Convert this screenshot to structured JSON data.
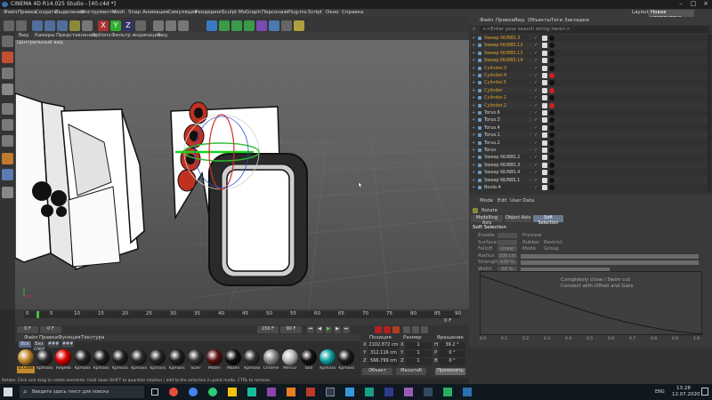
{
  "window": {
    "title": "CINEMA 4D R14.025 Studio - [40.c4d *]",
    "layout_label": "Layout:",
    "layout_value": "Новая компоновка"
  },
  "menu": [
    "Файл",
    "Правка",
    "Создать",
    "Выделение",
    "Инструменты",
    "Mesh",
    "Snap",
    "Анимация",
    "Симуляция",
    "Рендеринг",
    "Sculpt",
    "MoGraph",
    "Персонаж",
    "Plug-ins",
    "Script",
    "Окно",
    "Справка"
  ],
  "viewport": {
    "menu": [
      "Вид",
      "Камеры",
      "Представление",
      "Options",
      "Фильтр индикации",
      "Вид"
    ],
    "label": "Центральный вид"
  },
  "timeline": {
    "ticks": [
      "0",
      "5",
      "10",
      "15",
      "20",
      "25",
      "30",
      "35",
      "40",
      "45",
      "50",
      "55",
      "60",
      "65",
      "70",
      "75",
      "80",
      "85",
      "90"
    ],
    "start": "0 F",
    "current": "0 F",
    "end": "90 F",
    "end2": "150 F"
  },
  "materials": {
    "menu": [
      "Файл",
      "Правка",
      "Функция",
      "Текстура"
    ],
    "filters": [
      "Все",
      "Без слоя",
      "###",
      "###"
    ],
    "items": [
      "Ll.Ceoh",
      "Kpmaxo",
      "Reqeeb",
      "Kpmaxs",
      "Kpmaxs",
      "Kpmaxs",
      "Kpmaxs",
      "Kpmaxs",
      "Kpmaxs",
      "SDSr",
      "Materi",
      "Materi",
      "Kpmaxo",
      "Chrome",
      "Mercur",
      "Ball",
      "Kpmaxs",
      "Kpmaxs"
    ],
    "colors": [
      "#c28a2e",
      "#2a2a2a",
      "#e00000",
      "#222222",
      "#1e1e1e",
      "#222222",
      "#2a2a2a",
      "#262626",
      "#202020",
      "#303030",
      "#5a1010",
      "#101010",
      "#303030",
      "#888888",
      "#bbbbbb",
      "#111111",
      "#12a3a3",
      "#1a1a1a"
    ]
  },
  "coords": {
    "headers": [
      "Позиция",
      "Размер",
      "Вращение"
    ],
    "rows": [
      {
        "axis": "X",
        "pos": "2102.872 cm",
        "size": "1",
        "rot_axis": "H",
        "rot": "39.2 °"
      },
      {
        "axis": "Y",
        "pos": "312.116 cm",
        "size": "1",
        "rot_axis": "P",
        "rot": "0 °"
      },
      {
        "axis": "Z",
        "pos": "566.799 cm",
        "size": "1",
        "rot_axis": "B",
        "rot": "0 °"
      }
    ],
    "mode": "Объект",
    "size_mode": "Масштаб",
    "apply": "Применить"
  },
  "status": "Rotate: Click and drag to rotate elements. Hold down SHIFT to quantize rotation / add to the selection in point mode, CTRL to remove.",
  "objects": {
    "menu": [
      "Файл",
      "Правка",
      "Вид",
      "Объекты",
      "Теги",
      "Закладки"
    ],
    "search_placeholder": "<<Enter your search string here>>",
    "rows": [
      {
        "name": "Sweep NURBS.3",
        "color": "#e0a030"
      },
      {
        "name": "Sweep NURBS.12",
        "color": "#e0a030"
      },
      {
        "name": "Sweep NURBS.13",
        "color": "#e0a030"
      },
      {
        "name": "Sweep NURBS.14",
        "color": "#e0a030"
      },
      {
        "name": "Cylinder.3",
        "color": "#e0a030"
      },
      {
        "name": "Cylinder.4",
        "color": "#e0a030"
      },
      {
        "name": "Cylinder.5",
        "color": "#e0a030"
      },
      {
        "name": "Cylinder",
        "color": "#e0a030"
      },
      {
        "name": "Cylinder.1",
        "color": "#e0a030"
      },
      {
        "name": "Cylinder.2",
        "color": "#e0a030"
      },
      {
        "name": "Torus.6",
        "color": "#cfcfcf"
      },
      {
        "name": "Torus.3",
        "color": "#cfcfcf"
      },
      {
        "name": "Torus.4",
        "color": "#cfcfcf"
      },
      {
        "name": "Torus.1",
        "color": "#cfcfcf"
      },
      {
        "name": "Torus.2",
        "color": "#cfcfcf"
      },
      {
        "name": "Torus",
        "color": "#cfcfcf"
      },
      {
        "name": "Sweep NURBS.2",
        "color": "#cfcfcf"
      },
      {
        "name": "Sweep NURBS.3",
        "color": "#cfcfcf"
      },
      {
        "name": "Sweep NURBS.4",
        "color": "#cfcfcf"
      },
      {
        "name": "Sweep NURBS.1",
        "color": "#cfcfcf"
      },
      {
        "name": "Boole.4",
        "color": "#cfcfcf"
      }
    ]
  },
  "attributes": {
    "menu": [
      "Mode",
      "Edit",
      "User Data"
    ],
    "object": "Rotate",
    "tabs": [
      "Modelling Axis",
      "Object Axis",
      "Soft Selection"
    ],
    "section": "Soft Selection",
    "fields": [
      {
        "label": "Enable",
        "value": "",
        "extra_label": "Preview",
        "extra_value": ""
      },
      {
        "label": "Surface",
        "value": "",
        "extra_label": "Rubber",
        "extra_value": "Restrict"
      },
      {
        "label": "Falloff",
        "value": "Linear",
        "extra_label": "Mode",
        "extra_value": "Group"
      },
      {
        "label": "Radius",
        "value": "100 cm",
        "extra_label": "",
        "extra_value": ""
      },
      {
        "label": "Strength",
        "value": "100 %",
        "extra_label": "",
        "extra_value": ""
      },
      {
        "label": "Width",
        "value": "50 %",
        "extra_label": "",
        "extra_value": ""
      }
    ],
    "graph_notes": [
      "Completely close / Swim cut",
      "Connect with Offset and Gate"
    ],
    "graph_ticks": [
      "0.0",
      "0.1",
      "0.2",
      "0.3",
      "0.4",
      "0.5",
      "0.6",
      "0.7",
      "0.8",
      "0.9",
      "1.0"
    ]
  },
  "taskbar": {
    "search_placeholder": "Введите здесь текст для поиска",
    "time": "13:28",
    "date": "12.07.2020",
    "lang": "ENG"
  }
}
